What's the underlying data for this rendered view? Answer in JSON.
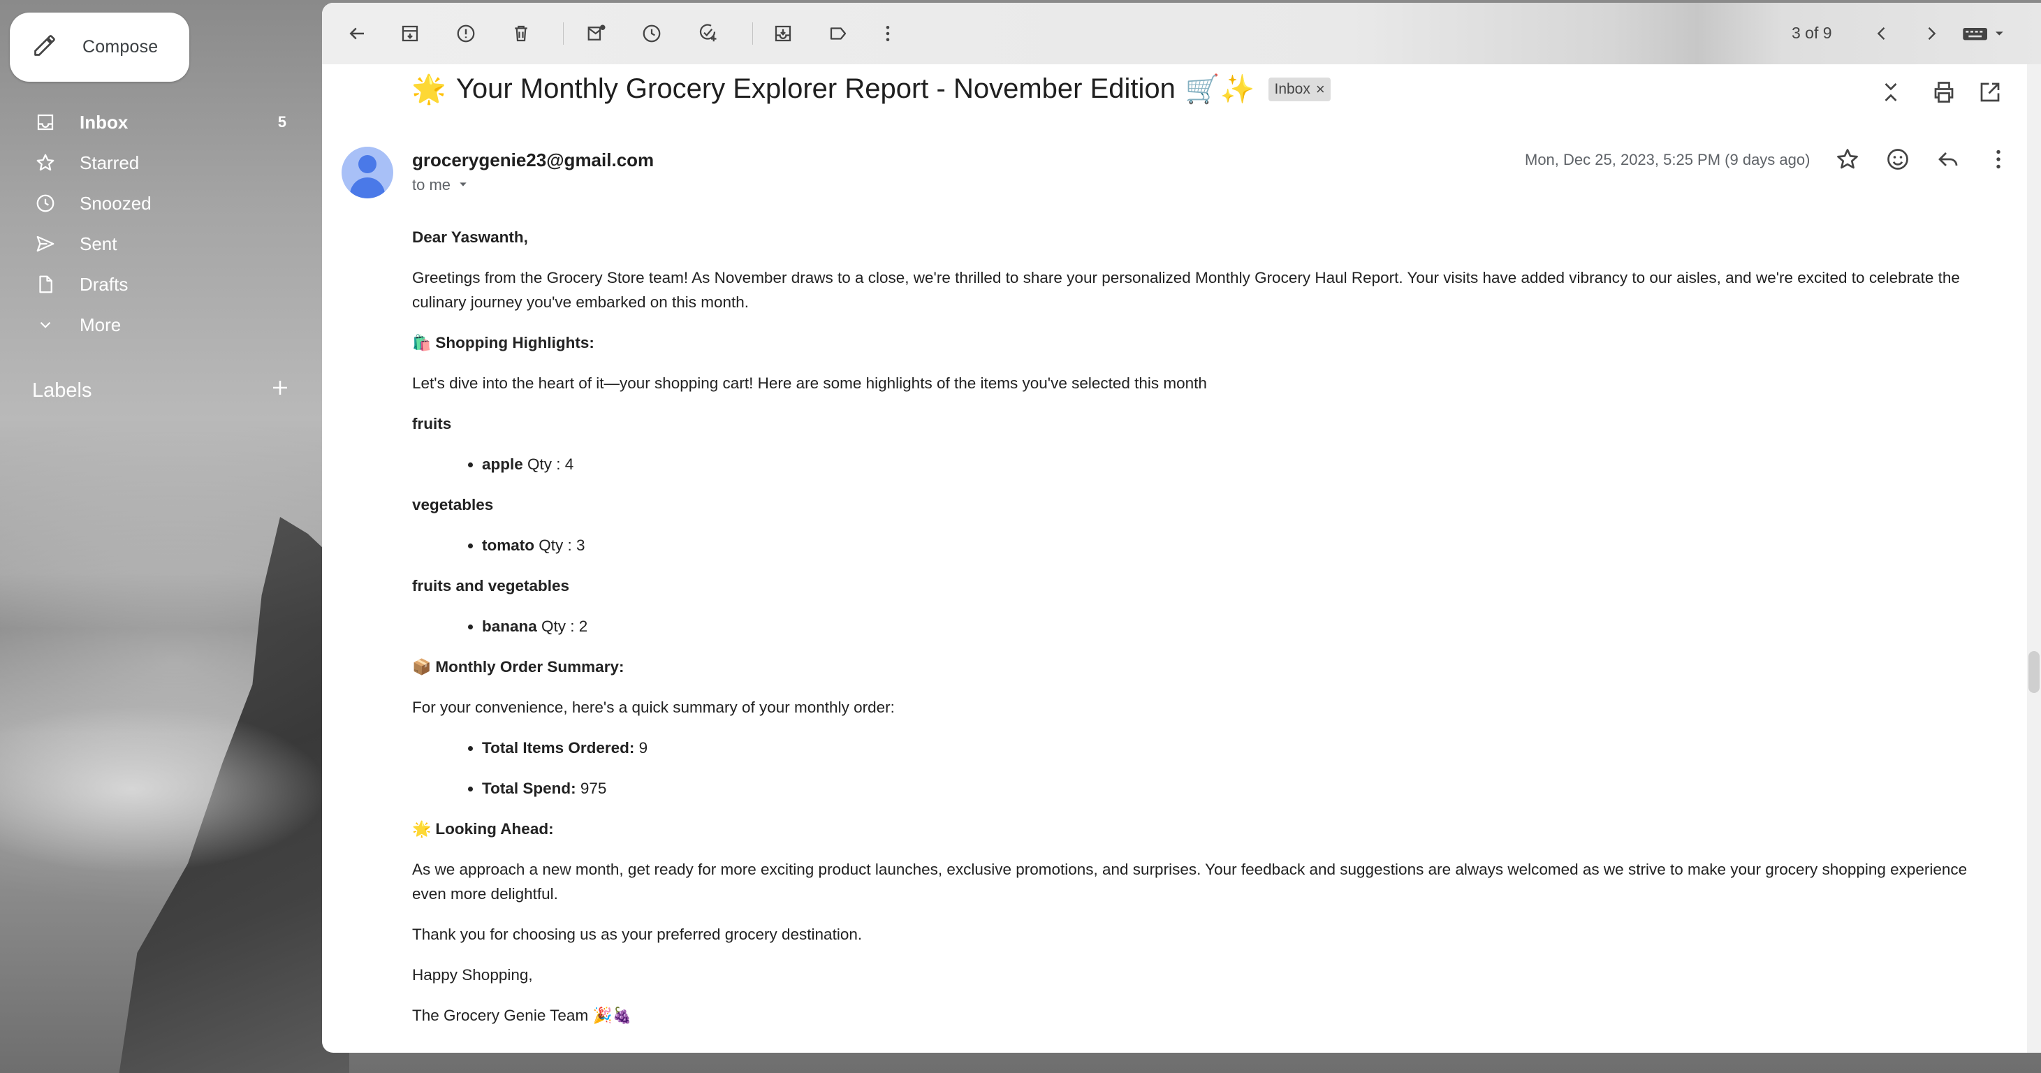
{
  "compose": {
    "label": "Compose",
    "icon": "pencil-icon"
  },
  "sidebar": {
    "items": [
      {
        "label": "Inbox",
        "count": "5",
        "icon": "inbox-icon",
        "active": true
      },
      {
        "label": "Starred",
        "icon": "star-icon"
      },
      {
        "label": "Snoozed",
        "icon": "clock-icon"
      },
      {
        "label": "Sent",
        "icon": "send-icon"
      },
      {
        "label": "Drafts",
        "icon": "draft-icon"
      },
      {
        "label": "More",
        "icon": "chevron-down-icon"
      }
    ],
    "labels_header": "Labels"
  },
  "toolbar": {
    "pager": "3 of 9",
    "icons": [
      "back-arrow-icon",
      "archive-icon",
      "report-spam-icon",
      "delete-icon",
      "mark-unread-icon",
      "snooze-icon",
      "add-task-icon",
      "move-to-icon",
      "label-icon",
      "more-vert-icon",
      "newer-icon",
      "older-icon",
      "keyboard-icon"
    ]
  },
  "email": {
    "subject": "Your Monthly Grocery Explorer Report - November Edition",
    "subject_prefix_emoji": "🌟",
    "subject_suffix_emoji": "🛒✨",
    "label_chip": "Inbox",
    "sender": "grocerygenie23@gmail.com",
    "to": "to me",
    "date": "Mon, Dec 25, 2023, 5:25 PM (9 days ago)",
    "greeting": "Dear Yaswanth,",
    "intro": "Greetings from the Grocery Store team! As November draws to a close, we're thrilled to share your personalized Monthly Grocery Haul Report. Your visits have added vibrancy to our aisles, and we're excited to celebrate the culinary journey you've embarked on this month.",
    "highlights_emoji": "🛍️",
    "highlights_heading": "Shopping Highlights:",
    "highlights_intro": "Let's dive into the heart of it—your shopping cart! Here are some highlights of the items you've selected this month",
    "categories": [
      {
        "name": "fruits",
        "items": [
          {
            "name": "apple",
            "qty": "Qty : 4"
          }
        ]
      },
      {
        "name": "vegetables",
        "items": [
          {
            "name": "tomato",
            "qty": "Qty : 3"
          }
        ]
      },
      {
        "name": "fruits and vegetables",
        "items": [
          {
            "name": "banana",
            "qty": "Qty : 2"
          }
        ]
      }
    ],
    "summary_emoji": "📦",
    "summary_heading": "Monthly Order Summary:",
    "summary_intro": "For your convenience, here's a quick summary of your monthly order:",
    "summary_items": [
      {
        "label": "Total Items Ordered:",
        "value": "9"
      },
      {
        "label": "Total Spend:",
        "value": "975"
      }
    ],
    "ahead_emoji": "🌟",
    "ahead_heading": "Looking Ahead:",
    "ahead_text": "As we approach a new month, get ready for more exciting product launches, exclusive promotions, and surprises. Your feedback and suggestions are always welcomed as we strive to make your grocery shopping experience even more delightful.",
    "thanks": "Thank you for choosing us as your preferred grocery destination.",
    "closing": "Happy Shopping,",
    "signature": "The Grocery Genie Team",
    "signature_emoji": "🎉🍇"
  }
}
